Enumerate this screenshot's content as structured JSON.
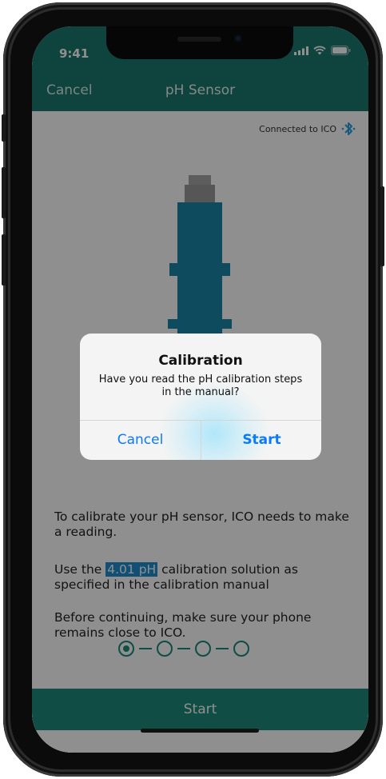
{
  "status_bar": {
    "time": "9:41"
  },
  "nav": {
    "cancel_label": "Cancel",
    "title": "pH Sensor"
  },
  "connection": {
    "text": "Connected to ICO",
    "icon": "bluetooth-icon",
    "icon_color": "#2a9fe0"
  },
  "instructions": {
    "p1": "To calibrate your pH sensor, ICO needs to make a reading.",
    "p2_before": "Use the ",
    "p2_highlight": "4.01 pH",
    "p2_after": " calibration solution as specified in the calibration manual",
    "p3": "Before continuing, make sure your phone remains close to ICO."
  },
  "progress": {
    "total_steps": 4,
    "current_step": 1
  },
  "bottom_button": {
    "label": "Start"
  },
  "alert": {
    "title": "Calibration",
    "message": "Have you read the pH calibration steps in the manual?",
    "cancel_label": "Cancel",
    "confirm_label": "Start"
  },
  "colors": {
    "brand": "#1c8a7c",
    "accent": "#1f8fcf",
    "ios_blue": "#0a7aff"
  }
}
